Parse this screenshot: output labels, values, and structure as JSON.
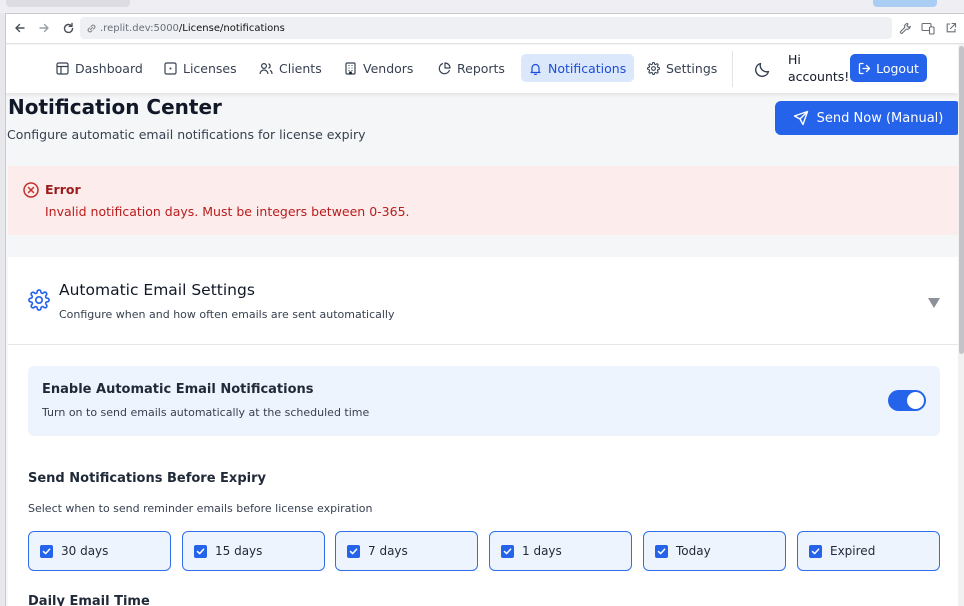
{
  "browser": {
    "url_host": ".replit.dev:5000",
    "url_path": "/License/notifications"
  },
  "nav": {
    "items": [
      {
        "label": "Dashboard",
        "icon": "layout-icon"
      },
      {
        "label": "Licenses",
        "icon": "square-icon"
      },
      {
        "label": "Clients",
        "icon": "users-icon"
      },
      {
        "label": "Vendors",
        "icon": "building-icon"
      },
      {
        "label": "Reports",
        "icon": "pie-chart-icon"
      },
      {
        "label": "Notifications",
        "icon": "bell-icon",
        "active": true
      },
      {
        "label": "Settings",
        "icon": "gear-icon"
      }
    ],
    "greeting": "Hi accounts!",
    "logout_label": "Logout"
  },
  "header": {
    "title": "Notification Center",
    "subtitle": "Configure automatic email notifications for license expiry",
    "send_label": "Send Now (Manual)"
  },
  "error": {
    "title": "Error",
    "message": "Invalid notification days. Must be integers between 0-365."
  },
  "settings": {
    "title": "Automatic Email Settings",
    "subtitle": "Configure when and how often emails are sent automatically",
    "enable_title": "Enable Automatic Email Notifications",
    "enable_subtitle": "Turn on to send emails automatically at the scheduled time",
    "enabled": true,
    "before_title": "Send Notifications Before Expiry",
    "before_subtitle": "Select when to send reminder emails before license expiration",
    "options": [
      {
        "label": "30 days",
        "checked": true
      },
      {
        "label": "15 days",
        "checked": true
      },
      {
        "label": "7 days",
        "checked": true
      },
      {
        "label": "1 days",
        "checked": true
      },
      {
        "label": "Today",
        "checked": true
      },
      {
        "label": "Expired",
        "checked": true
      }
    ],
    "daily_title": "Daily Email Time"
  },
  "colors": {
    "accent": "#2563eb",
    "active_nav_bg": "#dbe8fb",
    "error_bg": "#fdecec",
    "error_text": "#b91c1c"
  }
}
